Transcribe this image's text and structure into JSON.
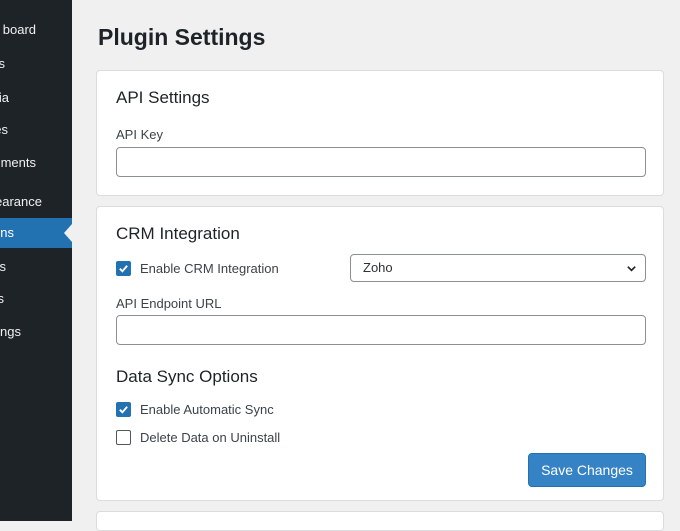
{
  "sidebar": {
    "items": [
      {
        "label": "Dashboard",
        "active": false
      },
      {
        "label": "Posts",
        "active": false
      },
      {
        "label": "Media",
        "active": false
      },
      {
        "label": "Pages",
        "active": false
      },
      {
        "label": "Comments",
        "active": false
      },
      {
        "label": "Appearance",
        "active": false
      },
      {
        "label": "Plugins",
        "active": true
      },
      {
        "label": "Users",
        "active": false
      },
      {
        "label": "Tools",
        "active": false
      },
      {
        "label": "Settings",
        "active": false
      }
    ],
    "visible_text": [
      "board",
      "s",
      "ia",
      "es",
      "ments",
      "earance",
      "ns",
      "s",
      "s",
      "ngs"
    ]
  },
  "page": {
    "title": "Plugin Settings"
  },
  "api_settings": {
    "title": "API Settings",
    "api_key_label": "API Key",
    "api_key_value": ""
  },
  "crm": {
    "title": "CRM Integration",
    "enable_label": "Enable CRM Integration",
    "enable_checked": true,
    "provider_selected": "Zoho",
    "endpoint_label": "API Endpoint URL",
    "endpoint_value": ""
  },
  "sync": {
    "title": "Data Sync Options",
    "auto_sync_label": "Enable Automatic Sync",
    "auto_sync_checked": true,
    "delete_label": "Delete Data on Uninstall",
    "delete_checked": false
  },
  "actions": {
    "save_label": "Save Changes"
  },
  "colors": {
    "accent": "#2271b1",
    "sidebar_bg": "#1d2327",
    "button": "#3582c4"
  }
}
